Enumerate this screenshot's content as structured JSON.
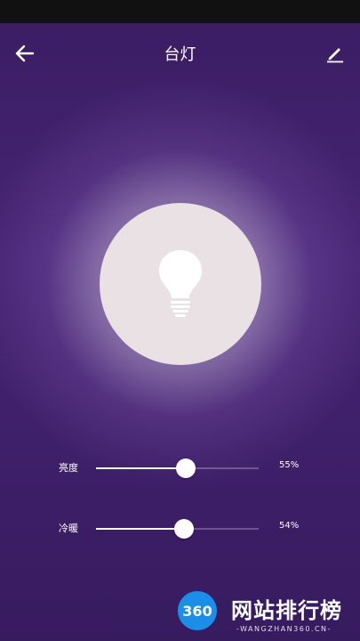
{
  "header": {
    "title": "台灯"
  },
  "controls": [
    {
      "label": "亮度",
      "value": 55,
      "value_text": "55%"
    },
    {
      "label": "冷暖",
      "value": 54,
      "value_text": "54%"
    }
  ],
  "watermark": {
    "logo": "360",
    "text": "网站排行榜",
    "sub": "-WANGZHAN360.CN-"
  },
  "colors": {
    "background": "#3f2068",
    "bulb_circle": "#e9e1e3",
    "accent": "#ffffff"
  }
}
